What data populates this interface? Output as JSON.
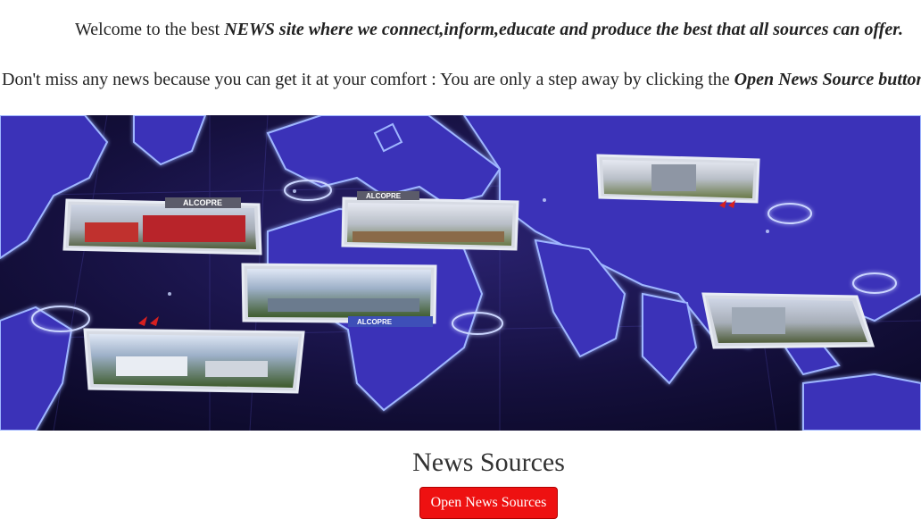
{
  "intro": {
    "prefix": "Welcome to the best ",
    "emphasis": "NEWS site where we connect,inform,educate and produce the best that all sources can offer."
  },
  "promo": {
    "prefix": "Don't miss any news because you can get it at your comfort : You are only a step away by clicking the ",
    "emphasis": "Open News Source button"
  },
  "banner": {
    "sign_label_1": "ALCOPRE",
    "sign_label_2": "ALCOPRE",
    "sign_label_3": "ALCOPRE"
  },
  "news_section": {
    "title": "News Sources",
    "button_label": "Open News Sources"
  },
  "colors": {
    "button": "#ee1111",
    "map_background": "#1a1446",
    "map_land": "#3b33b8",
    "map_glow": "#9fb6ff"
  }
}
